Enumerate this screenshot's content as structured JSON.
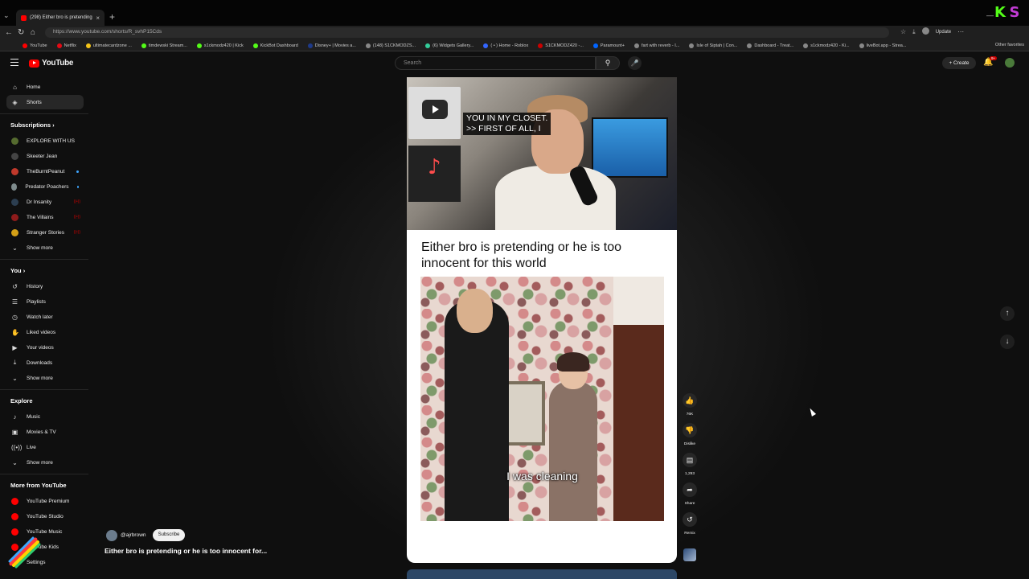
{
  "browser": {
    "tab_title": "(298) Either bro is pretending",
    "url": "https://www.youtube.com/shorts/R_svhP15Cds",
    "update_label": "Update",
    "other_favorites": "Other favorites",
    "bookmarks": [
      {
        "label": "YouTube",
        "color": "#ff0000"
      },
      {
        "label": "Netflix",
        "color": "#e50914"
      },
      {
        "label": "ultimatecardzone ...",
        "color": "#f5c518"
      },
      {
        "label": "timdewski Stream...",
        "color": "#53fc18"
      },
      {
        "label": "s1ckmodz420 | Kick",
        "color": "#53fc18"
      },
      {
        "label": "KickBot Dashboard",
        "color": "#53fc18"
      },
      {
        "label": "Disney+ | Movies a...",
        "color": "#1e3a8a"
      },
      {
        "label": "(148) S1CKMODZS...",
        "color": "#888888"
      },
      {
        "label": "(6) Widgets Gallery...",
        "color": "#33cc99"
      },
      {
        "label": "( • ) Home - Roblox",
        "color": "#3366ff"
      },
      {
        "label": "S1CKMODZ420 -...",
        "color": "#cc0000"
      },
      {
        "label": "Paramount+",
        "color": "#0064ff"
      },
      {
        "label": "fart with reverb - I...",
        "color": "#888888"
      },
      {
        "label": "Isle of Siptah | Con...",
        "color": "#888888"
      },
      {
        "label": "Dashboard - Treat...",
        "color": "#888888"
      },
      {
        "label": "s1ckmodz420 - Ki...",
        "color": "#888888"
      },
      {
        "label": "liveBot.app - Strea...",
        "color": "#888888"
      }
    ]
  },
  "header": {
    "logo_text": "YouTube",
    "search_placeholder": "Search",
    "create_label": "+ Create",
    "notification_count": "9+"
  },
  "sidebar": {
    "top": [
      {
        "label": "Home",
        "icon": "home-icon",
        "glyph": "⌂"
      },
      {
        "label": "Shorts",
        "icon": "shorts-icon",
        "glyph": "◈",
        "active": true
      }
    ],
    "subscriptions_heading": "Subscriptions",
    "subscriptions": [
      {
        "label": "EXPLORE WITH US",
        "color": "#556b2f",
        "badge": ""
      },
      {
        "label": "Skeeter Jean",
        "color": "#444444",
        "badge": ""
      },
      {
        "label": "TheBurntPeanut",
        "color": "#c0392b",
        "badge": "dot"
      },
      {
        "label": "Predator Poachers",
        "color": "#7f8c8d",
        "badge": "dot"
      },
      {
        "label": "Dr Insanity",
        "color": "#2c3e50",
        "badge": "live"
      },
      {
        "label": "The Villains",
        "color": "#8e1b1b",
        "badge": "live"
      },
      {
        "label": "Stranger Stories",
        "color": "#d4a017",
        "badge": "live"
      }
    ],
    "show_more": "Show more",
    "you_heading": "You",
    "you_items": [
      {
        "label": "History",
        "glyph": "↺",
        "icon": "history-icon"
      },
      {
        "label": "Playlists",
        "glyph": "☰",
        "icon": "playlists-icon"
      },
      {
        "label": "Watch later",
        "glyph": "◷",
        "icon": "watch-later-icon"
      },
      {
        "label": "Liked videos",
        "glyph": "✋",
        "icon": "liked-icon"
      },
      {
        "label": "Your videos",
        "glyph": "▶",
        "icon": "your-videos-icon"
      },
      {
        "label": "Downloads",
        "glyph": "⤓",
        "icon": "downloads-icon"
      },
      {
        "label": "Show more",
        "glyph": "⌄",
        "icon": "chevron-down-icon"
      }
    ],
    "explore_heading": "Explore",
    "explore_items": [
      {
        "label": "Music",
        "glyph": "♪",
        "icon": "music-icon"
      },
      {
        "label": "Movies & TV",
        "glyph": "▣",
        "icon": "movies-icon"
      },
      {
        "label": "Live",
        "glyph": "((•))",
        "icon": "live-icon"
      },
      {
        "label": "Show more",
        "glyph": "⌄",
        "icon": "chevron-down-icon"
      }
    ],
    "more_heading": "More from YouTube",
    "more_items": [
      {
        "label": "YouTube Premium",
        "color": "#ff0000"
      },
      {
        "label": "YouTube Studio",
        "color": "#ff0000"
      },
      {
        "label": "YouTube Music",
        "color": "#ff0000"
      },
      {
        "label": "YouTube Kids",
        "color": "#ff0000"
      }
    ],
    "settings": "Settings"
  },
  "video": {
    "caption_top_line1": "YOU IN MY CLOSET.",
    "caption_top_line2": ">> FIRST OF ALL, I",
    "meme_title": "Either bro is pretending or he is too innocent for this world",
    "caption_bottom": "I was cleaning",
    "channel": "@ajrbrown",
    "subscribe_label": "Subscribe",
    "title": "Either bro is pretending or he is too innocent for..."
  },
  "actions": {
    "likes": "76K",
    "dislike": "Dislike",
    "comments": "1,293",
    "share": "Share",
    "remix": "Remix"
  },
  "colors": {
    "accent": "#ff0000",
    "background": "#0f0f0f"
  }
}
